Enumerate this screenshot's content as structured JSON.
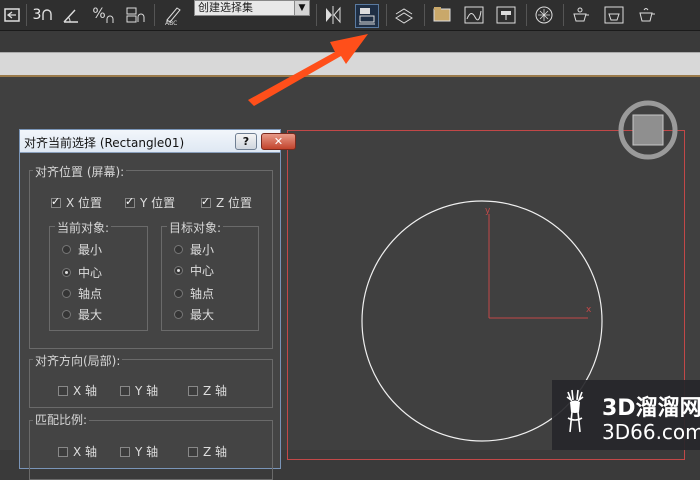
{
  "toolbar": {
    "spinner_snap_label": "3",
    "selection_set_dropdown": "创建选择集",
    "icons": [
      "undo-icon",
      "snap-3d-icon",
      "angle-snap-icon",
      "percent-snap-icon",
      "spinner-snap-icon",
      "edit-named-selection-icon",
      "mirror-icon",
      "align-icon",
      "layer-manager-icon",
      "scene-explorer-icon",
      "curve-editor-icon",
      "schematic-view-icon",
      "material-editor-icon",
      "render-setup-icon",
      "rendered-frame-window-icon",
      "render-production-icon"
    ],
    "accent_color": "#ff4f1a"
  },
  "dialog": {
    "title": "对齐当前选择 (Rectangle01)",
    "help_label": "?",
    "close_label": "✕",
    "align_position": {
      "label": "对齐位置 (屏幕):",
      "x_label": "X 位置",
      "y_label": "Y 位置",
      "z_label": "Z 位置",
      "x_checked": true,
      "y_checked": true,
      "z_checked": true
    },
    "current_object": {
      "label": "当前对象:",
      "options": [
        "最小",
        "中心",
        "轴点",
        "最大"
      ],
      "selected": "中心"
    },
    "target_object": {
      "label": "目标对象:",
      "options": [
        "最小",
        "中心",
        "轴点",
        "最大"
      ],
      "selected": "中心"
    },
    "align_orientation": {
      "label": "对齐方向(局部):",
      "x_label": "X 轴",
      "y_label": "Y 轴",
      "z_label": "Z 轴"
    },
    "match_scale": {
      "label": "匹配比例:",
      "x_label": "X 轴",
      "y_label": "Y 轴",
      "z_label": "Z 轴"
    }
  },
  "viewport": {
    "frame_color": "#c24848",
    "gizmo_y_label": "y",
    "gizmo_x_label": "x"
  },
  "watermark": {
    "title": "3D溜溜网",
    "subtitle": "3D66.com"
  }
}
